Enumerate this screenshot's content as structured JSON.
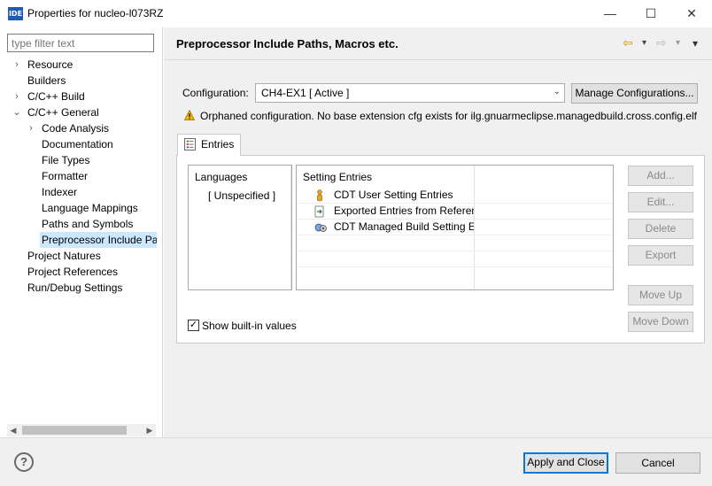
{
  "window": {
    "app_icon": "IDE",
    "title": "Properties for nucleo-l073RZ",
    "controls": {
      "minimize": "—",
      "maximize": "☐",
      "close": "✕"
    }
  },
  "filter": {
    "placeholder": "type filter text"
  },
  "tree": [
    {
      "label": "Resource",
      "expander": "›"
    },
    {
      "label": "Builders",
      "expander": ""
    },
    {
      "label": "C/C++ Build",
      "expander": "›"
    },
    {
      "label": "C/C++ General",
      "expander": "⌄"
    },
    {
      "label": "Code Analysis",
      "expander": "›"
    },
    {
      "label": "Documentation",
      "expander": ""
    },
    {
      "label": "File Types",
      "expander": ""
    },
    {
      "label": "Formatter",
      "expander": ""
    },
    {
      "label": "Indexer",
      "expander": ""
    },
    {
      "label": "Language Mappings",
      "expander": ""
    },
    {
      "label": "Paths and Symbols",
      "expander": ""
    },
    {
      "label": "Preprocessor Include Pat",
      "expander": ""
    },
    {
      "label": "Project Natures",
      "expander": ""
    },
    {
      "label": "Project References",
      "expander": ""
    },
    {
      "label": "Run/Debug Settings",
      "expander": ""
    }
  ],
  "page": {
    "title": "Preprocessor Include Paths, Macros etc.",
    "nav": {
      "back": "⇦",
      "back_menu": "▾",
      "forward": "⇨",
      "forward_menu": "▾",
      "view_menu": "▾"
    },
    "configuration": {
      "label": "Configuration:",
      "value": "CH4-EX1  [ Active ]",
      "manage_button": "Manage Configurations..."
    },
    "warning": "Orphaned configuration. No base extension cfg exists for ilg.gnuarmeclipse.managedbuild.cross.config.elf",
    "tab": "Entries",
    "languages": {
      "header": "Languages",
      "items": [
        "[ Unspecified ]"
      ]
    },
    "setting_entries": {
      "header": "Setting Entries",
      "items": [
        {
          "label": "CDT User Setting Entries",
          "icon": "person-icon"
        },
        {
          "label": "Exported Entries from Referenc",
          "icon": "exported-entries-icon"
        },
        {
          "label": "CDT Managed Build Setting En",
          "icon": "managed-build-icon"
        }
      ]
    },
    "buttons": {
      "add": "Add...",
      "edit": "Edit...",
      "delete": "Delete",
      "export": "Export",
      "move_up": "Move Up",
      "move_down": "Move Down"
    },
    "show_builtin": {
      "label": "Show built-in values",
      "checked": true
    }
  },
  "footer": {
    "help": "?",
    "apply_close": "Apply and Close",
    "cancel": "Cancel"
  },
  "colors": {
    "selection": "#cce8ff",
    "accent": "#0078d7",
    "warning": "#e8a800"
  }
}
